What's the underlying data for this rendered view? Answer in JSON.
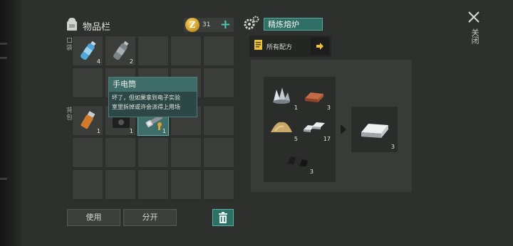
{
  "inventory": {
    "title": "物品栏",
    "pocket_label": "口袋",
    "backpack_label": "背包"
  },
  "coins": {
    "symbol": "Z",
    "count": "31",
    "plus": "+"
  },
  "pocket_slots": [
    {
      "item": "water-bottle",
      "count": "4"
    },
    {
      "item": "empty-bottle",
      "count": "2"
    },
    {
      "item": "",
      "count": ""
    },
    {
      "item": "",
      "count": ""
    },
    {
      "item": "",
      "count": ""
    },
    {
      "item": "",
      "count": ""
    },
    {
      "item": "",
      "count": ""
    },
    {
      "item": "",
      "count": ""
    },
    {
      "item": "",
      "count": ""
    },
    {
      "item": "",
      "count": ""
    }
  ],
  "backpack_slots": [
    {
      "item": "lighter",
      "count": "1"
    },
    {
      "item": "camera-device",
      "count": "1"
    },
    {
      "item": "flashlight",
      "count": "1",
      "selected": true
    },
    {
      "item": "",
      "count": ""
    },
    {
      "item": "",
      "count": ""
    },
    {
      "item": "",
      "count": ""
    },
    {
      "item": "",
      "count": ""
    },
    {
      "item": "",
      "count": ""
    },
    {
      "item": "",
      "count": ""
    },
    {
      "item": "",
      "count": ""
    },
    {
      "item": "",
      "count": ""
    },
    {
      "item": "",
      "count": ""
    },
    {
      "item": "",
      "count": ""
    },
    {
      "item": "",
      "count": ""
    },
    {
      "item": "",
      "count": ""
    }
  ],
  "tooltip": {
    "title": "手电筒",
    "line1": "坏了，但如果拿到电子实验",
    "line2": "室里拆掉或许会派得上用场"
  },
  "buttons": {
    "use": "使用",
    "split": "分开"
  },
  "smelter": {
    "name": "精炼熔炉",
    "all_recipes": "所有配方"
  },
  "recipe": {
    "ingredients": [
      {
        "item": "crystal-ore",
        "count": "1"
      },
      {
        "item": "copper-ingot",
        "count": "3"
      },
      {
        "item": "sand-pile",
        "count": "5"
      },
      {
        "item": "silver-ingots",
        "count": "17"
      },
      {
        "item": "coal",
        "count": "3"
      }
    ],
    "output": {
      "item": "silver-ingot",
      "count": "3"
    }
  },
  "close_label": "关闭",
  "colors": {
    "accent": "#2f6f66",
    "accent_light": "#4cc6b4",
    "panel": "#383b38",
    "background": "#2e302e"
  }
}
